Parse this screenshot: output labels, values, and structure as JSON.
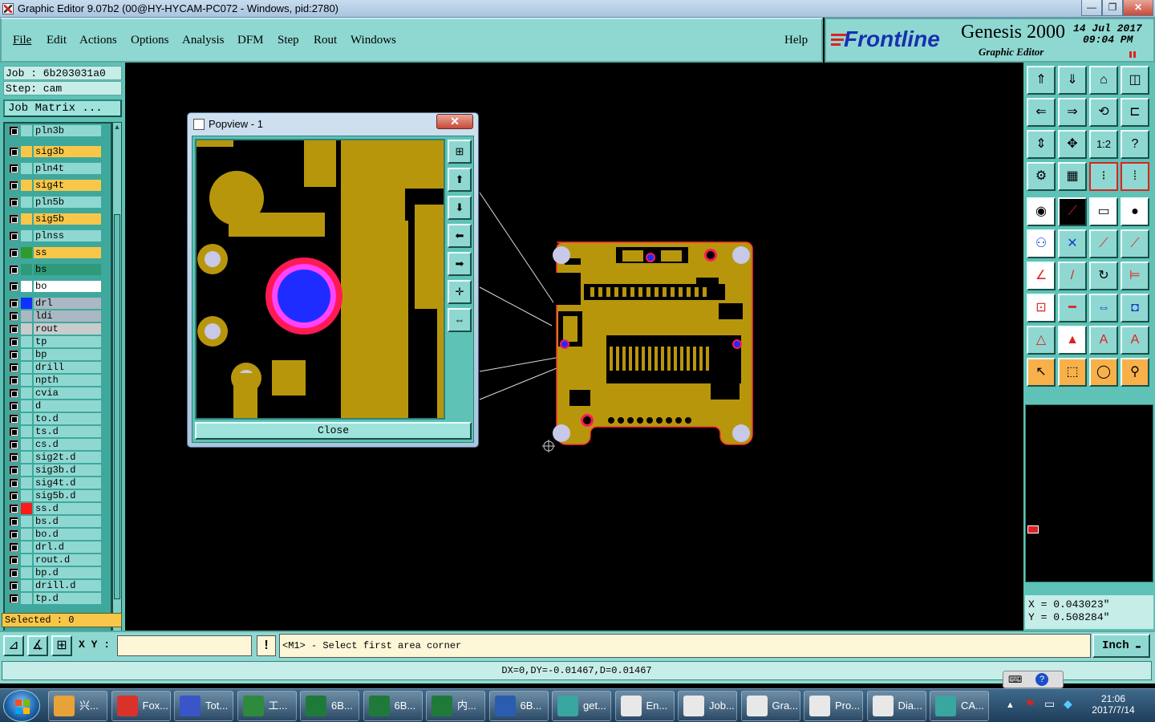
{
  "window": {
    "title": "Graphic Editor 9.07b2 (00@HY-HYCAM-PC072 - Windows, pid:2780)",
    "min": "—",
    "max": "❐",
    "close": "✕"
  },
  "menu": [
    "File",
    "Edit",
    "Actions",
    "Options",
    "Analysis",
    "DFM",
    "Step",
    "Rout",
    "Windows"
  ],
  "help": "Help",
  "brand": {
    "logo": "Frontline",
    "product": "Genesis 2000",
    "subtitle": "Graphic Editor",
    "date": "14 Jul 2017",
    "time": "09:04 PM"
  },
  "job": {
    "job_label": "Job : 6b203031a0",
    "step_label": "Step: cam",
    "matrix_button": "Job Matrix ..."
  },
  "layers": [
    {
      "name": "pln3b",
      "color": "#8fd8d1",
      "swatch": "#8fd8d1",
      "edit": ""
    },
    {
      "name": "sig3b",
      "color": "#f8c74a",
      "swatch": "#f8c74a",
      "edit": "✎"
    },
    {
      "name": "pln4t",
      "color": "#8fd8d1",
      "swatch": "#8fd8d1",
      "edit": ""
    },
    {
      "name": "sig4t",
      "color": "#f8c74a",
      "swatch": "#f8c74a",
      "edit": "✎"
    },
    {
      "name": "pln5b",
      "color": "#8fd8d1",
      "swatch": "#8fd8d1",
      "edit": ""
    },
    {
      "name": "sig5b",
      "color": "#f8c74a",
      "swatch": "#f8c74a",
      "edit": "✎"
    },
    {
      "name": "plnss",
      "color": "#8fd8d1",
      "swatch": "#8fd8d1",
      "edit": ""
    },
    {
      "name": "ss",
      "color": "#f8c74a",
      "swatch": "#2f9a2f",
      "edit": "✎▦"
    },
    {
      "name": "bs",
      "color": "#2f9a7a",
      "swatch": "#2f9a7a",
      "edit": "✎"
    },
    {
      "name": "bo",
      "color": "#ffffff",
      "swatch": "#ffffff",
      "edit": "✎"
    },
    {
      "name": "drl",
      "color": "#a9b8c2",
      "swatch": "#1030ff",
      "edit": ""
    },
    {
      "name": "ldi",
      "color": "#a9b8c2",
      "swatch": "#a9b8c2",
      "edit": ""
    },
    {
      "name": "rout",
      "color": "#c8cccc",
      "swatch": "#c8cccc",
      "edit": ""
    },
    {
      "name": "tp",
      "color": "#8fd8d1",
      "swatch": "#8fd8d1",
      "edit": "✎"
    },
    {
      "name": "bp",
      "color": "#8fd8d1",
      "swatch": "#8fd8d1",
      "edit": "✎"
    },
    {
      "name": "drill",
      "color": "#8fd8d1",
      "swatch": "#8fd8d1",
      "edit": "✎"
    },
    {
      "name": "npth",
      "color": "#8fd8d1",
      "swatch": "#8fd8d1",
      "edit": ""
    },
    {
      "name": "cvia",
      "color": "#8fd8d1",
      "swatch": "#8fd8d1",
      "edit": ""
    },
    {
      "name": "d",
      "color": "#8fd8d1",
      "swatch": "#8fd8d1",
      "edit": ""
    },
    {
      "name": "to.d",
      "color": "#8fd8d1",
      "swatch": "#8fd8d1",
      "edit": "✎"
    },
    {
      "name": "ts.d",
      "color": "#8fd8d1",
      "swatch": "#8fd8d1",
      "edit": "✎"
    },
    {
      "name": "cs.d",
      "color": "#8fd8d1",
      "swatch": "#8fd8d1",
      "edit": "✎"
    },
    {
      "name": "sig2t.d",
      "color": "#8fd8d1",
      "swatch": "#8fd8d1",
      "edit": "✎"
    },
    {
      "name": "sig3b.d",
      "color": "#8fd8d1",
      "swatch": "#8fd8d1",
      "edit": "✎"
    },
    {
      "name": "sig4t.d",
      "color": "#8fd8d1",
      "swatch": "#8fd8d1",
      "edit": "✎"
    },
    {
      "name": "sig5b.d",
      "color": "#8fd8d1",
      "swatch": "#8fd8d1",
      "edit": "✎"
    },
    {
      "name": "ss.d",
      "color": "#8fd8d1",
      "swatch": "#ff1a1a",
      "edit": "✎"
    },
    {
      "name": "bs.d",
      "color": "#8fd8d1",
      "swatch": "#8fd8d1",
      "edit": "✎"
    },
    {
      "name": "bo.d",
      "color": "#8fd8d1",
      "swatch": "#8fd8d1",
      "edit": "✎"
    },
    {
      "name": "drl.d",
      "color": "#8fd8d1",
      "swatch": "#8fd8d1",
      "edit": ""
    },
    {
      "name": "rout.d",
      "color": "#8fd8d1",
      "swatch": "#8fd8d1",
      "edit": ""
    },
    {
      "name": "bp.d",
      "color": "#8fd8d1",
      "swatch": "#8fd8d1",
      "edit": "✎"
    },
    {
      "name": "drill.d",
      "color": "#8fd8d1",
      "swatch": "#8fd8d1",
      "edit": "✎"
    },
    {
      "name": "tp.d",
      "color": "#8fd8d1",
      "swatch": "#8fd8d1",
      "edit": ""
    }
  ],
  "selected": "Selected : 0",
  "popview": {
    "title": "Popview - 1",
    "close_button": "Close"
  },
  "coords": {
    "x": "X = 0.043023\"",
    "y": "Y = 0.508284\""
  },
  "xy_label": "X Y :",
  "xy_value": "",
  "prompt": "<M1> - Select first area corner",
  "units": "Inch",
  "status": "DX=0,DY=-0.01467,D=0.01467",
  "taskbar": {
    "items": [
      {
        "label": "兴...",
        "icon": "#e8a23a"
      },
      {
        "label": "Fox...",
        "icon": "#d9322b"
      },
      {
        "label": "Tot...",
        "icon": "#3a55c8"
      },
      {
        "label": "工...",
        "icon": "#2e8b3e"
      },
      {
        "label": "6B...",
        "icon": "#1f7a3a"
      },
      {
        "label": "6B...",
        "icon": "#1f7a3a"
      },
      {
        "label": "内...",
        "icon": "#1f7a3a"
      },
      {
        "label": "6B...",
        "icon": "#2a5db0"
      },
      {
        "label": "get...",
        "icon": "#3aa6a0"
      },
      {
        "label": "En...",
        "icon": "#e8e8e8"
      },
      {
        "label": "Job...",
        "icon": "#e8e8e8"
      },
      {
        "label": "Gra...",
        "icon": "#e8e8e8"
      },
      {
        "label": "Pro...",
        "icon": "#e8e8e8"
      },
      {
        "label": "Dia...",
        "icon": "#e8e8e8"
      },
      {
        "label": "CA...",
        "icon": "#3aa6a0"
      }
    ],
    "clock_time": "21:06",
    "clock_date": "2017/7/14"
  },
  "colors": {
    "copper": "#b8960c",
    "pad": "#c8c8e8",
    "drill": "#1e2cff",
    "mask_ring": "#ff1a55",
    "outline": "#ff3333"
  }
}
